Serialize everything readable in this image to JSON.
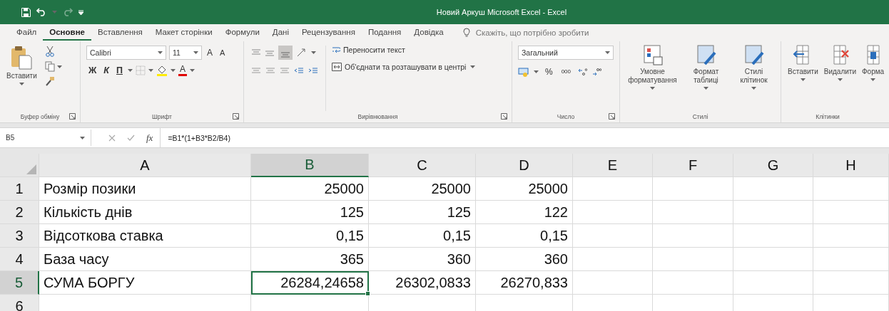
{
  "window": {
    "title": "Новий Аркуш Microsoft Excel  -  Excel"
  },
  "tabs": [
    {
      "label": "Файл",
      "selected": false
    },
    {
      "label": "Основне",
      "selected": true
    },
    {
      "label": "Вставлення",
      "selected": false
    },
    {
      "label": "Макет сторінки",
      "selected": false
    },
    {
      "label": "Формули",
      "selected": false
    },
    {
      "label": "Дані",
      "selected": false
    },
    {
      "label": "Рецензування",
      "selected": false
    },
    {
      "label": "Подання",
      "selected": false
    },
    {
      "label": "Довідка",
      "selected": false
    }
  ],
  "tell_me": {
    "placeholder": "Скажіть, що потрібно зробити"
  },
  "ribbon": {
    "clipboard": {
      "paste": "Вставити",
      "label": "Буфер обміну"
    },
    "font": {
      "name": "Calibri",
      "size": "11",
      "grow": "A",
      "shrink": "A",
      "bold": "Ж",
      "italic": "К",
      "underline": "П",
      "font_color_button": "A",
      "label": "Шрифт"
    },
    "alignment": {
      "wrap": "Переносити текст",
      "merge": "Об'єднати та розташувати в центрі",
      "label": "Вирівнювання"
    },
    "number": {
      "format": "Загальний",
      "percent": "%",
      "thousands": "000",
      "label": "Число"
    },
    "styles": {
      "buttons": [
        "Умовне форматування",
        "Формат таблиці",
        "Стилі клітинок"
      ],
      "label": "Стилі"
    },
    "cells": {
      "buttons": [
        "Вставити",
        "Видалити",
        "Форма"
      ],
      "label": "Клітинки"
    }
  },
  "formula_bar": {
    "name_box": "B5",
    "fx": "fx",
    "formula": "=B1*(1+B3*B2/B4)"
  },
  "sheet": {
    "columns": [
      {
        "label": "A",
        "selected": false
      },
      {
        "label": "B",
        "selected": true
      },
      {
        "label": "C",
        "selected": false
      },
      {
        "label": "D",
        "selected": false
      },
      {
        "label": "E",
        "selected": false
      },
      {
        "label": "F",
        "selected": false
      },
      {
        "label": "G",
        "selected": false
      },
      {
        "label": "H",
        "selected": false
      }
    ],
    "rows": [
      {
        "header": "1",
        "selected": false,
        "cells": [
          {
            "text": "Розмір позики",
            "kind": "text",
            "selected": false
          },
          {
            "text": "25000",
            "kind": "number",
            "selected": false
          },
          {
            "text": "25000",
            "kind": "number",
            "selected": false
          },
          {
            "text": "25000",
            "kind": "number",
            "selected": false
          }
        ]
      },
      {
        "header": "2",
        "selected": false,
        "cells": [
          {
            "text": "Кількість днів",
            "kind": "text",
            "selected": false
          },
          {
            "text": "125",
            "kind": "number",
            "selected": false
          },
          {
            "text": "125",
            "kind": "number",
            "selected": false
          },
          {
            "text": "122",
            "kind": "number",
            "selected": false
          }
        ]
      },
      {
        "header": "3",
        "selected": false,
        "cells": [
          {
            "text": "Відсоткова ставка",
            "kind": "text",
            "selected": false
          },
          {
            "text": "0,15",
            "kind": "number",
            "selected": false
          },
          {
            "text": "0,15",
            "kind": "number",
            "selected": false
          },
          {
            "text": "0,15",
            "kind": "number",
            "selected": false
          }
        ]
      },
      {
        "header": "4",
        "selected": false,
        "cells": [
          {
            "text": "База часу",
            "kind": "text",
            "selected": false
          },
          {
            "text": "365",
            "kind": "number",
            "selected": false
          },
          {
            "text": "360",
            "kind": "number",
            "selected": false
          },
          {
            "text": "360",
            "kind": "number",
            "selected": false
          }
        ]
      },
      {
        "header": "5",
        "selected": true,
        "cells": [
          {
            "text": "СУМА БОРГУ",
            "kind": "text",
            "selected": false
          },
          {
            "text": "26284,24658",
            "kind": "number",
            "selected": true
          },
          {
            "text": "26302,0833",
            "kind": "number",
            "selected": false
          },
          {
            "text": "26270,833",
            "kind": "number",
            "selected": false
          }
        ]
      },
      {
        "header": "6",
        "selected": false,
        "cells": []
      }
    ]
  }
}
